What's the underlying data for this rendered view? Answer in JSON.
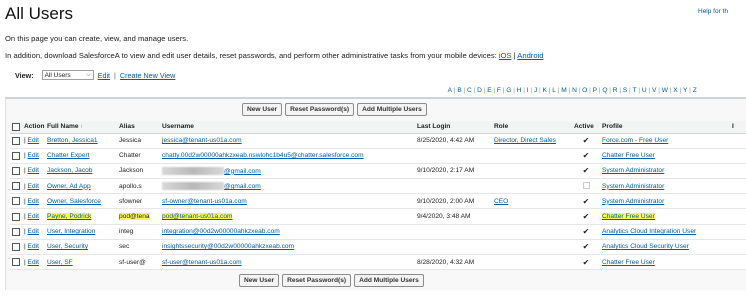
{
  "page": {
    "title": "All Users",
    "help_link": "Help for th",
    "intro_1": "On this page you can create, view, and manage users.",
    "intro_2_prefix": "In addition, download SalesforceA to view and edit user details, reset passwords, and perform other administrative tasks from your mobile devices: ",
    "ios_link": "iOS",
    "divider": " | ",
    "android_link": "Android"
  },
  "view": {
    "label": "View:",
    "selected": "All Users",
    "edit_link": "Edit",
    "separator": "|",
    "create_link": "Create New View"
  },
  "alphabet": [
    "A",
    "B",
    "C",
    "D",
    "E",
    "F",
    "G",
    "H",
    "I",
    "J",
    "K",
    "L",
    "M",
    "N",
    "O",
    "P",
    "Q",
    "R",
    "S",
    "T",
    "U",
    "V",
    "W",
    "X",
    "Y",
    "Z"
  ],
  "buttons": {
    "new_user": "New User",
    "reset_password": "Reset Password(s)",
    "add_multiple": "Add Multiple Users"
  },
  "columns": {
    "action": "Action",
    "full_name": "Full Name",
    "sort_indicator": "↑",
    "alias": "Alias",
    "username": "Username",
    "last_login": "Last Login",
    "role": "Role",
    "active": "Active",
    "profile": "Profile",
    "extra": "I"
  },
  "edit_label": "Edit",
  "users": [
    {
      "name": "Bretton, Jessica1",
      "alias": "Jessica",
      "username": "jessica@tenant-us01a.com",
      "last_login": "8/25/2020, 4:42 AM",
      "role": "Director, Direct Sales",
      "active": true,
      "profile": "Force.com - Free User"
    },
    {
      "name": "Chatter Expert",
      "alias": "Chatter",
      "username": "chatty.00d2w00000ahkzxeab.nswlohc1b4u5@chatter.salesforce.com",
      "last_login": "",
      "role": "",
      "active": true,
      "profile": "Chatter Free User"
    },
    {
      "name": "Jackson, Jacob",
      "alias": "Jackson",
      "username": "@gmail.com",
      "username_redacted": true,
      "last_login": "9/10/2020, 2:17 AM",
      "role": "",
      "active": true,
      "profile": "System Administrator"
    },
    {
      "name": "Owner, Ad App",
      "alias": "apollo.s",
      "username": "@gmail.com",
      "username_redacted": true,
      "last_login": "",
      "role": "",
      "active": false,
      "profile": "System Administrator"
    },
    {
      "name": "Owner, Salesforce",
      "alias": "sfowner",
      "username": "sf-owner@tenant-us01a.com",
      "last_login": "9/10/2020, 2:00 AM",
      "role": "CEO",
      "active": true,
      "profile": "System Administrator"
    },
    {
      "name": "Payne, Podrick",
      "alias": "pod@tena",
      "username": "pod@tenant-us01a.com",
      "last_login": "9/4/2020, 3:48 AM",
      "role": "",
      "active": true,
      "profile": "Chatter Free User",
      "highlighted": true
    },
    {
      "name": "User, Integration",
      "alias": "integ",
      "username": "integration@00d2w00000ahkzxeab.com",
      "last_login": "",
      "role": "",
      "active": true,
      "profile": "Analytics Cloud Integration User"
    },
    {
      "name": "User, Security",
      "alias": "sec",
      "username": "insightssecurity@00d2w00000ahkzxeab.com",
      "last_login": "",
      "role": "",
      "active": true,
      "profile": "Analytics Cloud Security User"
    },
    {
      "name": "User, SF",
      "alias": "sf-user@",
      "username": "sf-user@tenant-us01a.com",
      "last_login": "8/28/2020, 4:32 AM",
      "role": "",
      "active": true,
      "profile": "Chatter Free User"
    }
  ],
  "colors": {
    "link": "#015ba7",
    "highlight": "#fdfb4f",
    "header_bar": "#cfd2d6"
  }
}
